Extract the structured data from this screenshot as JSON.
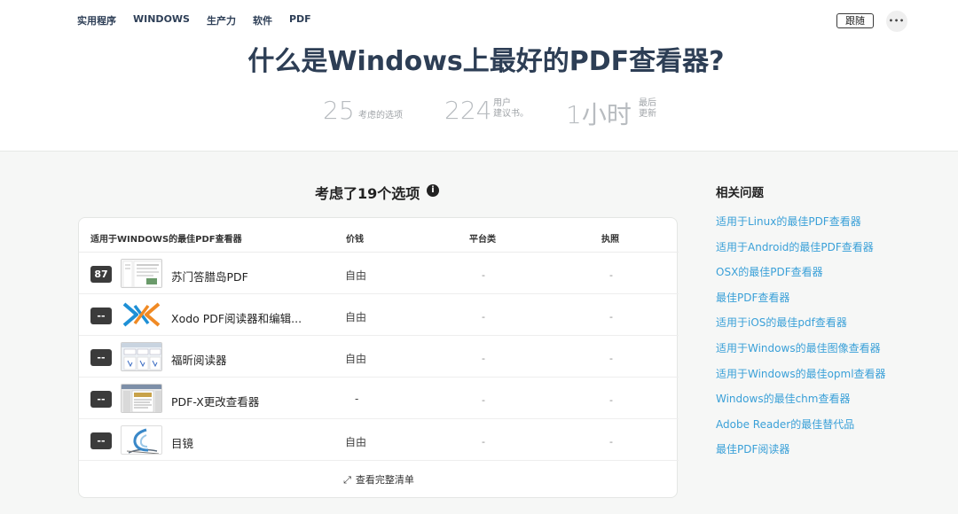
{
  "breadcrumb": [
    "实用程序",
    "WINDOWS",
    "生产力",
    "软件",
    "PDF"
  ],
  "header": {
    "follow_label": "跟随",
    "more_label": "•••",
    "title": "什么是Windows上最好的PDF查看器?"
  },
  "stats": [
    {
      "value": "25",
      "label": "考虑的选项"
    },
    {
      "value": "224",
      "label_line1": "用户",
      "label_line2": "建议书。"
    },
    {
      "value": "1小时",
      "label_line1": "最后",
      "label_line2": "更新"
    }
  ],
  "section": {
    "title": "考虑了19个选项",
    "info_icon": "i"
  },
  "table": {
    "headers": [
      "适用于WINDOWS的最佳PDF查看器",
      "价钱",
      "平台类",
      "执照"
    ],
    "rows": [
      {
        "score": "87",
        "name": "苏门答腊岛PDF",
        "price": "自由",
        "platforms": "-",
        "license": "-",
        "thumb": "sumatra"
      },
      {
        "score": "--",
        "name": "Xodo PDF阅读器和编辑...",
        "price": "自由",
        "platforms": "-",
        "license": "-",
        "thumb": "xodo"
      },
      {
        "score": "--",
        "name": "福昕阅读器",
        "price": "自由",
        "platforms": "-",
        "license": "-",
        "thumb": "foxit"
      },
      {
        "score": "--",
        "name": "PDF-X更改查看器",
        "price": "-",
        "platforms": "-",
        "license": "-",
        "thumb": "pdfx"
      },
      {
        "score": "--",
        "name": "目镜",
        "price": "自由",
        "platforms": "-",
        "license": "-",
        "thumb": "okular"
      }
    ],
    "full_list_label": "查看完整清单",
    "expand_icon": "⤢"
  },
  "related": {
    "title": "相关问题",
    "links": [
      "适用于Linux的最佳PDF查看器",
      "适用于Android的最佳PDF查看器",
      "OSX的最佳PDF查看器",
      "最佳PDF查看器",
      "适用于iOS的最佳pdf查看器",
      "适用于Windows的最佳图像查看器",
      "适用于Windows的最佳opml查看器",
      "Windows的最佳chm查看器",
      "Adobe Reader的最佳替代品",
      "最佳PDF阅读器"
    ]
  },
  "colors": {
    "title": "#2d3e55",
    "link": "#3aa0d8",
    "score_bg": "#3b3b3b",
    "page_bg": "#f6f7f6"
  }
}
